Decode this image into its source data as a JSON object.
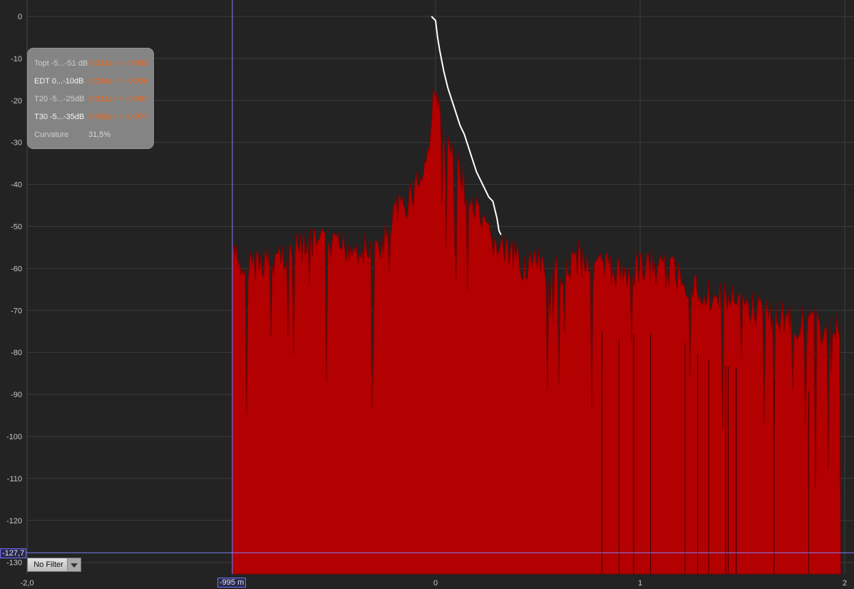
{
  "chart_data": {
    "type": "area",
    "title": "",
    "xlabel": "",
    "ylabel": "",
    "xlim": [
      -2.0,
      2.0
    ],
    "ylim": [
      -130,
      0
    ],
    "y_ticks": [
      "0",
      "-10",
      "-20",
      "-30",
      "-40",
      "-50",
      "-60",
      "-70",
      "-80",
      "-90",
      "-100",
      "-110",
      "-120",
      "-130"
    ],
    "x_ticks": [
      "-2,0",
      "0",
      "1",
      "2"
    ],
    "grid": true,
    "colors": {
      "fill": "#b30000",
      "envelope": "#7a0000",
      "decay": "#ffffff",
      "cursor": "#8080ff",
      "value": "#ff6a1a"
    },
    "envelope": {
      "x": [
        -0.995,
        -0.95,
        -0.9,
        -0.8,
        -0.7,
        -0.6,
        -0.5,
        -0.4,
        -0.3,
        -0.25,
        -0.2,
        -0.15,
        -0.1,
        -0.05,
        -0.02,
        0.0,
        0.02,
        0.05,
        0.1,
        0.15,
        0.2,
        0.25,
        0.3,
        0.35,
        0.4,
        0.5,
        0.6,
        0.7,
        0.8,
        0.9,
        1.0,
        1.1,
        1.2,
        1.3,
        1.4,
        1.5,
        1.6,
        1.7,
        1.8,
        1.9,
        1.98
      ],
      "y": [
        -52,
        -56,
        -54,
        -53,
        -51,
        -50,
        -51,
        -50,
        -52,
        -49,
        -43,
        -40,
        -36,
        -31,
        -22,
        -8,
        -20,
        -26,
        -30,
        -37,
        -43,
        -48,
        -50,
        -52,
        -54,
        -55,
        -56,
        -53,
        -55,
        -57,
        -55,
        -56,
        -57,
        -61,
        -63,
        -64,
        -66,
        -67,
        -69,
        -70,
        -68
      ]
    },
    "decay_curve": {
      "name": "",
      "x": [
        -0.02,
        0.0,
        0.01,
        0.02,
        0.04,
        0.06,
        0.08,
        0.1,
        0.12,
        0.14,
        0.16,
        0.18,
        0.2,
        0.22,
        0.24,
        0.26,
        0.28,
        0.3,
        0.31,
        0.32
      ],
      "y": [
        0,
        -1,
        -5,
        -8,
        -13,
        -17,
        -20,
        -23,
        -26,
        -28,
        -31,
        -34,
        -37,
        -39,
        -41,
        -43,
        -44,
        -48,
        -51,
        -52
      ]
    },
    "cursor_x": "-995 m",
    "cursor_y": "-127,7"
  },
  "panel": {
    "rows": [
      {
        "label": "Topt -5...-51 dB",
        "value": "0,233s r = -0,955"
      },
      {
        "label": "EDT  0...-10dB",
        "value": "0,234s r = -0,926"
      },
      {
        "label": "T20 -5...-25dB",
        "value": "0,331s r = -0,967"
      },
      {
        "label": "T30 -5...-35dB",
        "value": "0,438s r = -0,977"
      },
      {
        "label": "Curvature",
        "value": "31,5%"
      }
    ]
  },
  "filter": {
    "label": "No Filter"
  }
}
